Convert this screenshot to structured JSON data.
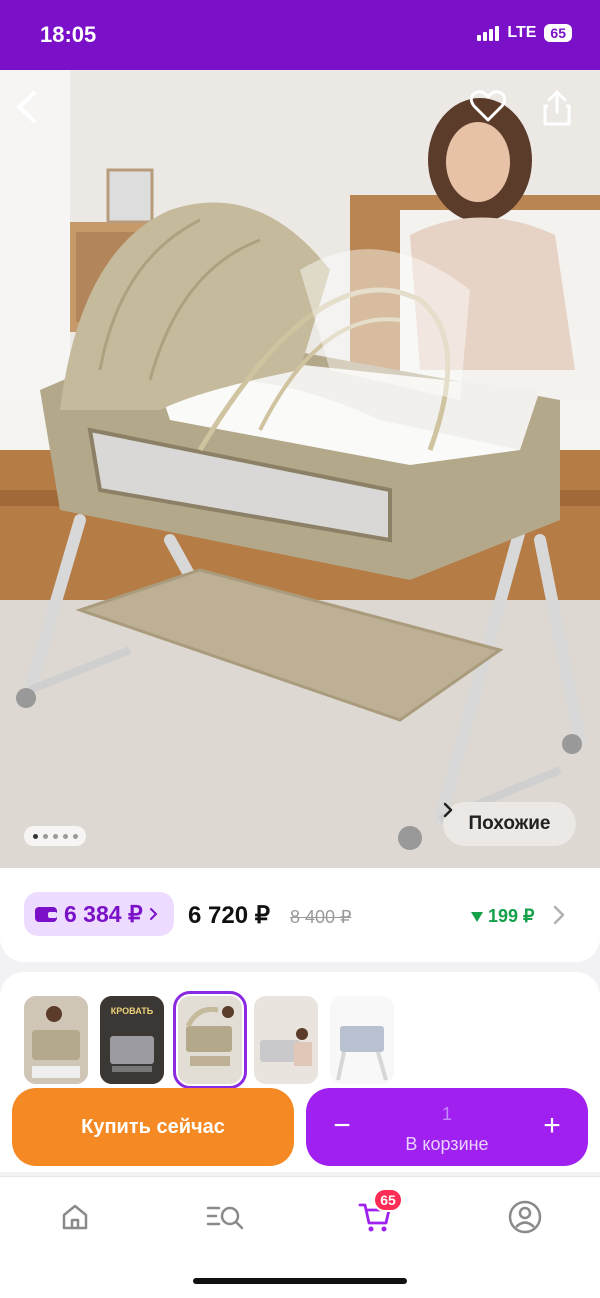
{
  "status_bar": {
    "time": "18:05",
    "network": "LTE",
    "battery": "65"
  },
  "gallery": {
    "similar_label": "Похожие",
    "dots_count": 5,
    "active_dot": 1
  },
  "prices": {
    "wallet_price": "6 384 ₽",
    "price": "6 720 ₽",
    "old_price": "8 400 ₽",
    "bonus": "199 ₽"
  },
  "actions": {
    "buy_now": "Купить сейчас",
    "cart_qty": "1",
    "cart_label": "В корзине",
    "minus": "−",
    "plus": "+"
  },
  "thumbnails": {
    "selected_index": 2,
    "thumb2_text": "КРОВАТЬ"
  },
  "tabbar": {
    "cart_badge": "65"
  },
  "colors": {
    "brand": "#7a10c8",
    "buy": "#f58a25",
    "cart": "#a020f0",
    "bonus": "#15a04a"
  }
}
